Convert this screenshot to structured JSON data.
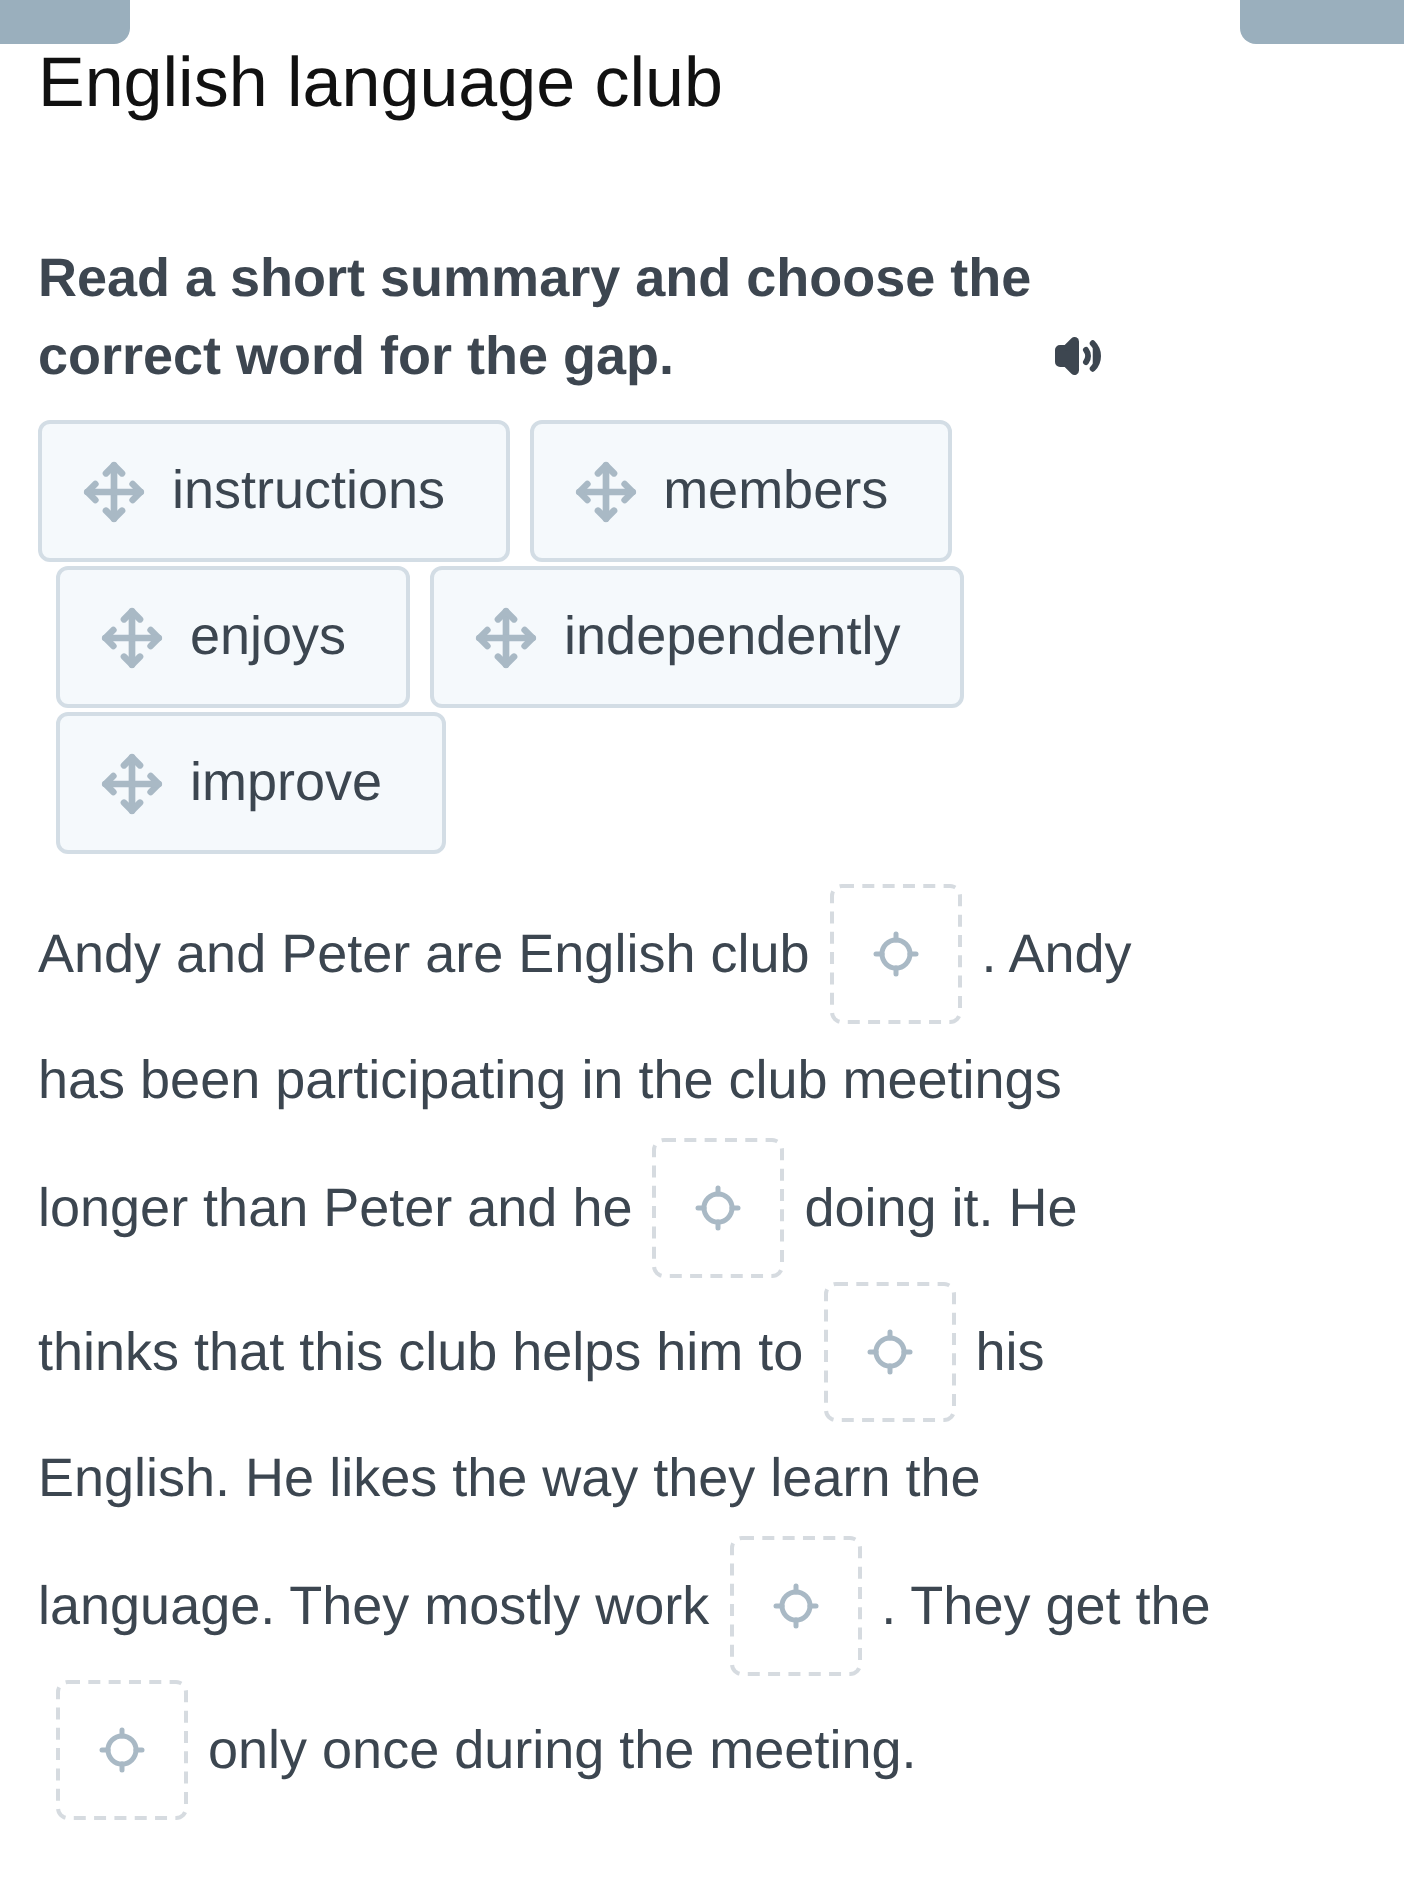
{
  "title": "English language club",
  "instruction": "Read a short summary and choose the correct word for the gap.",
  "word_bank": [
    [
      {
        "label": "instructions"
      },
      {
        "label": "members"
      }
    ],
    [
      {
        "label": "enjoys"
      },
      {
        "label": "independently"
      }
    ],
    [
      {
        "label": "improve"
      }
    ]
  ],
  "passage": [
    [
      {
        "kind": "text",
        "text": "Andy and Peter are English club"
      },
      {
        "kind": "gap"
      },
      {
        "kind": "text",
        "text": ". Andy"
      }
    ],
    [
      {
        "kind": "text",
        "text": "has been participating in the club meetings"
      }
    ],
    [
      {
        "kind": "text",
        "text": "longer than Peter and he"
      },
      {
        "kind": "gap"
      },
      {
        "kind": "text",
        "text": "doing it. He"
      }
    ],
    [
      {
        "kind": "text",
        "text": "thinks that this club helps him to"
      },
      {
        "kind": "gap"
      },
      {
        "kind": "text",
        "text": "his"
      }
    ],
    [
      {
        "kind": "text",
        "text": "English. He likes the way they learn the"
      }
    ],
    [
      {
        "kind": "text",
        "text": "language. They mostly work"
      },
      {
        "kind": "gap"
      },
      {
        "kind": "text",
        "text": ". They get the"
      }
    ],
    [
      {
        "kind": "gap"
      },
      {
        "kind": "text",
        "text": "only once during the meeting."
      }
    ]
  ]
}
